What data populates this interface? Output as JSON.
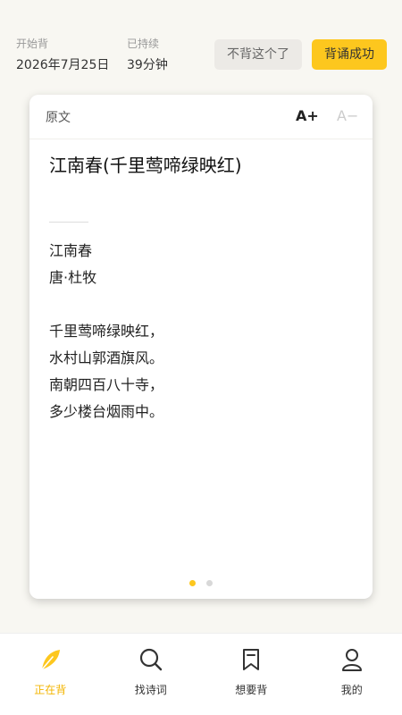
{
  "status": {
    "start_label": "开始背",
    "start_value": "2026年7月25日",
    "duration_label": "已持续",
    "duration_value": "39分钟"
  },
  "actions": {
    "quit_label": "不背这个了",
    "success_label": "背诵成功"
  },
  "card": {
    "tab_label": "原文",
    "font_up": "A+",
    "font_down": "A−",
    "title": "江南春(千里莺啼绿映红)",
    "poem_name": "江南春",
    "author": "唐·杜牧",
    "lines": [
      "千里莺啼绿映红，",
      "水村山郭酒旗风。",
      "南朝四百八十寺，",
      "多少楼台烟雨中。"
    ]
  },
  "nav": {
    "items": [
      {
        "label": "正在背",
        "icon": "feather-icon"
      },
      {
        "label": "找诗词",
        "icon": "search-icon"
      },
      {
        "label": "想要背",
        "icon": "bookmark-icon"
      },
      {
        "label": "我的",
        "icon": "user-icon"
      }
    ]
  },
  "colors": {
    "accent": "#fdc71e",
    "active_text": "#f3b500"
  }
}
